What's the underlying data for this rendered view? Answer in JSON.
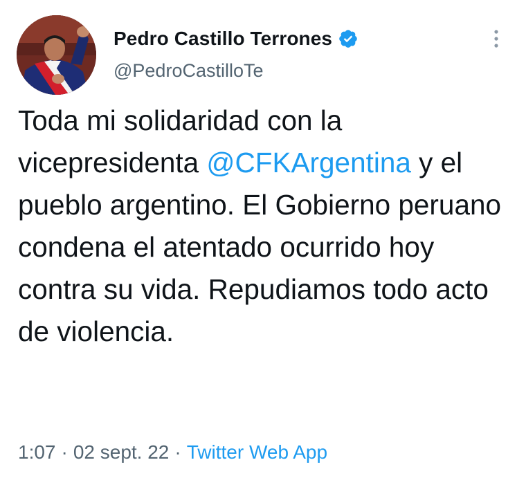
{
  "author": {
    "display_name": "Pedro Castillo Terrones",
    "handle": "@PedroCastilloTe",
    "verified_icon": "verified-badge-icon"
  },
  "tweet": {
    "text_parts": {
      "before_mention": "Toda mi solidaridad con la vicepresidenta ",
      "mention": "@CFKArgentina",
      "after_mention": " y el pueblo argentino. El Gobierno peruano condena el atentado ocurrido hoy contra su vida. Repudiamos todo acto de violencia."
    }
  },
  "meta": {
    "time": "1:07",
    "separator": "·",
    "date": "02 sept. 22",
    "source": "Twitter Web App"
  },
  "colors": {
    "accent": "#1d9bf0",
    "text": "#0f1419",
    "secondary": "#536471"
  },
  "icons": {
    "more": "more-vertical-icon"
  }
}
